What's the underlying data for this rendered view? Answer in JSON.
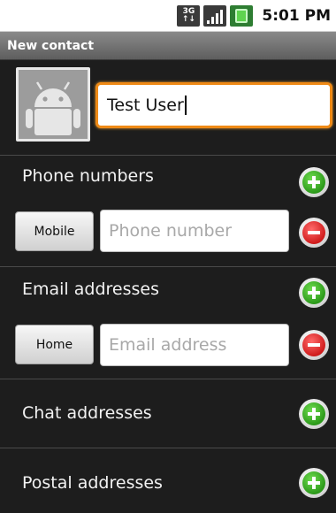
{
  "status_bar": {
    "network_label_top": "3G",
    "network_label_bottom": "↑↓",
    "time": "5:01 PM"
  },
  "title_bar": {
    "title": "New contact"
  },
  "name_field": {
    "value": "Test User"
  },
  "sections": {
    "phone": {
      "label": "Phone numbers",
      "type_button": "Mobile",
      "placeholder": "Phone number"
    },
    "email": {
      "label": "Email addresses",
      "type_button": "Home",
      "placeholder": "Email address"
    },
    "chat": {
      "label": "Chat addresses"
    },
    "postal": {
      "label": "Postal addresses"
    }
  },
  "colors": {
    "focus_accent": "#ef8a16",
    "add_green": "#2c9a1a",
    "remove_red": "#d01c1c",
    "background": "#1d1d1d"
  },
  "icons": {
    "add": "plus-circle-icon",
    "remove": "minus-circle-icon",
    "photo": "android-robot-icon",
    "battery": "battery-charging-icon",
    "signal": "signal-strength-icon",
    "network": "3g-data-icon"
  }
}
